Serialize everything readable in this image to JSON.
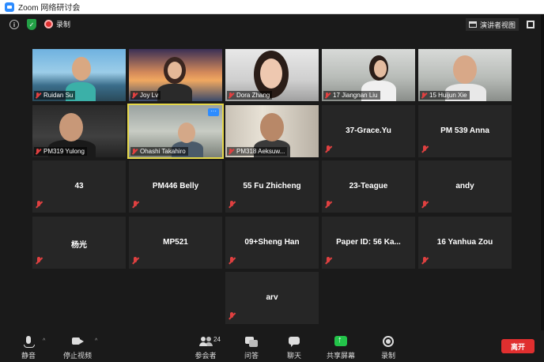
{
  "window": {
    "title": "Zoom 网络研讨会"
  },
  "topbar": {
    "recording_label": "录制",
    "speaker_view_label": "演讲者视图"
  },
  "video_tiles": [
    {
      "name": "Ruidan Su"
    },
    {
      "name": "Joy Lv"
    },
    {
      "name": "Dora Zhang"
    },
    {
      "name": "17 Jiangnan Liu"
    },
    {
      "name": "15 Huijun Xie"
    },
    {
      "name": "PM319 Yulong"
    },
    {
      "name": "Ohashi Takahiro"
    },
    {
      "name": "PM318 Aeksuw..."
    }
  ],
  "name_tiles": [
    {
      "name": "37-Grace.Yu"
    },
    {
      "name": "PM 539  Anna"
    },
    {
      "name": "43"
    },
    {
      "name": "PM446 Belly"
    },
    {
      "name": "55 Fu Zhicheng"
    },
    {
      "name": "23-Teague"
    },
    {
      "name": "andy"
    },
    {
      "name": "杨光"
    },
    {
      "name": "MP521"
    },
    {
      "name": "09+Sheng Han"
    },
    {
      "name": "Paper ID: 56 Ka..."
    },
    {
      "name": "16 Yanhua Zou"
    },
    {
      "name": "arv"
    }
  ],
  "toolbar": {
    "mute_label": "静音",
    "stop_video_label": "停止视频",
    "participants_label": "参会者",
    "participants_count": "24",
    "qa_label": "问答",
    "chat_label": "聊天",
    "share_screen_label": "共享屏幕",
    "record_label": "录制",
    "leave_label": "离开"
  },
  "colors": {
    "share_green": "#23c44a",
    "leave_red": "#e02f2f",
    "active_speaker_border": "#e6d84a",
    "zoom_blue": "#2d8cff"
  }
}
